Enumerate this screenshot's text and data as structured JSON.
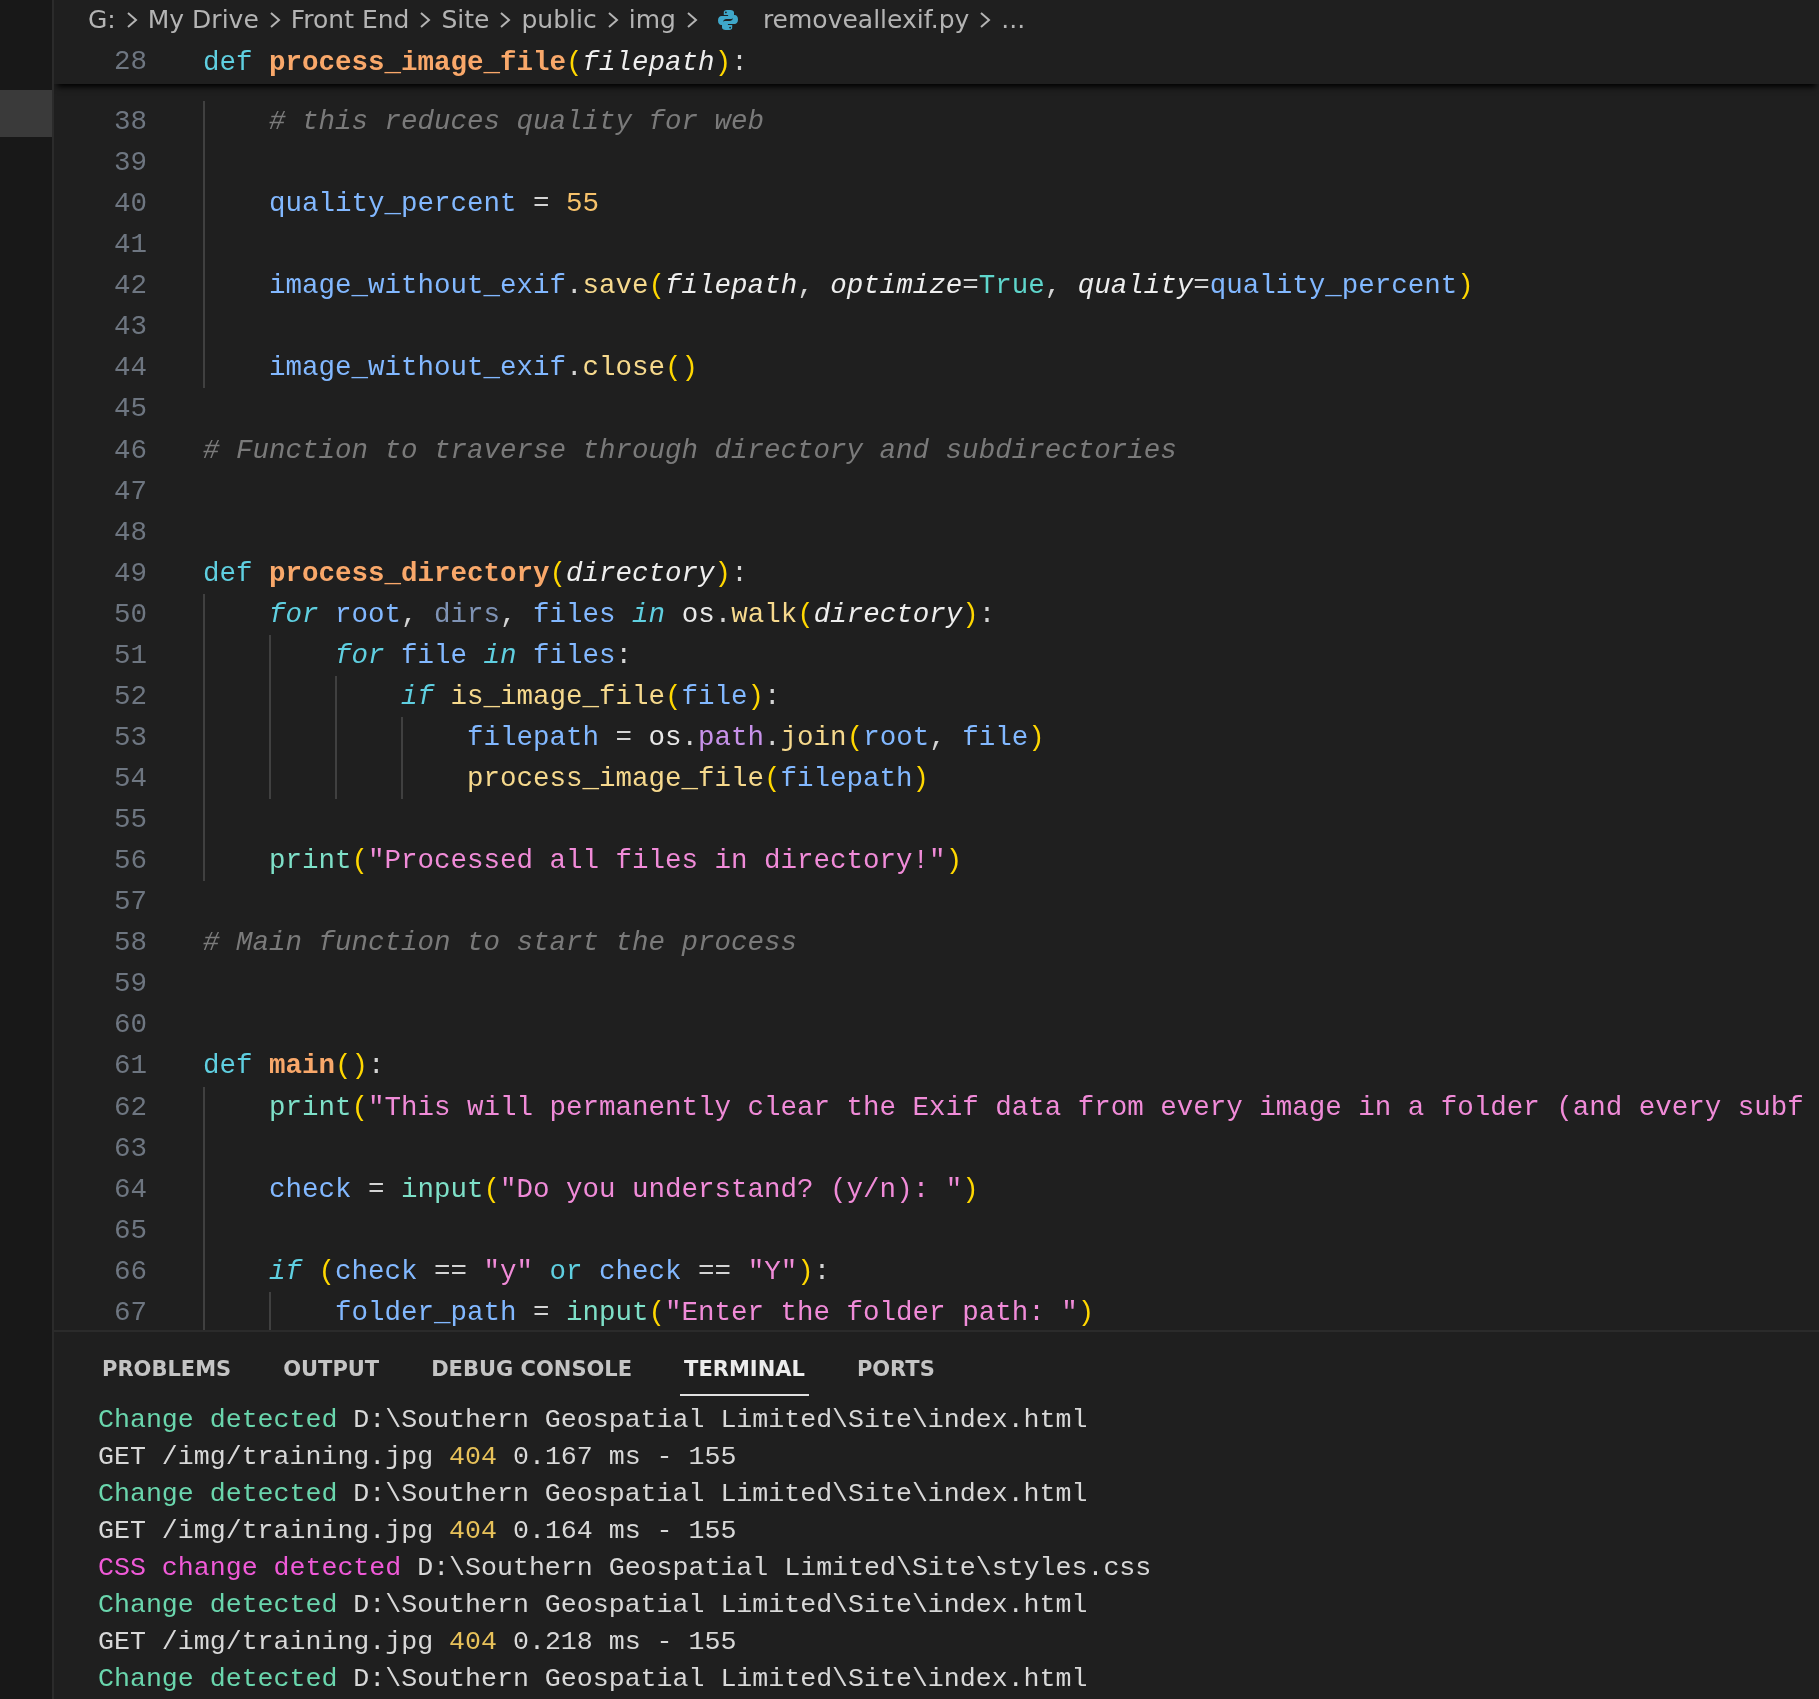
{
  "breadcrumb": {
    "items": [
      {
        "label": "G:"
      },
      {
        "label": "My Drive"
      },
      {
        "label": "Front End"
      },
      {
        "label": "Site"
      },
      {
        "label": "public"
      },
      {
        "label": "img"
      },
      {
        "label": "removeallexif.py",
        "kind": "file"
      },
      {
        "label": "..."
      }
    ]
  },
  "editor": {
    "sticky_line": {
      "number": "28",
      "tokens": [
        {
          "text": "def ",
          "kind": "kw"
        },
        {
          "text": "process_image_file",
          "kind": "fn"
        },
        {
          "text": "(",
          "kind": "paren"
        },
        {
          "text": "filepath",
          "kind": "param"
        },
        {
          "text": ")",
          "kind": "paren"
        },
        {
          "text": ":",
          "kind": "op"
        }
      ]
    },
    "lines": [
      {
        "number": "38",
        "tokens": [
          {
            "text": "    # this reduces quality for web",
            "kind": "comment"
          }
        ]
      },
      {
        "number": "39"
      },
      {
        "number": "40",
        "tokens": [
          {
            "text": "    quality_percent",
            "kind": "var"
          },
          {
            "text": " = ",
            "kind": "op"
          },
          {
            "text": "55",
            "kind": "num"
          }
        ]
      },
      {
        "number": "41"
      },
      {
        "number": "42",
        "tokens": [
          {
            "text": "    image_without_exif",
            "kind": "var"
          },
          {
            "text": ".",
            "kind": "op"
          },
          {
            "text": "save",
            "kind": "method"
          },
          {
            "text": "(",
            "kind": "paren"
          },
          {
            "text": "filepath",
            "kind": "param"
          },
          {
            "text": ", ",
            "kind": "op"
          },
          {
            "text": "optimize",
            "kind": "param"
          },
          {
            "text": "=",
            "kind": "op"
          },
          {
            "text": "True",
            "kind": "const"
          },
          {
            "text": ", ",
            "kind": "op"
          },
          {
            "text": "quality",
            "kind": "param"
          },
          {
            "text": "=",
            "kind": "op"
          },
          {
            "text": "quality_percent",
            "kind": "var"
          },
          {
            "text": ")",
            "kind": "paren"
          }
        ]
      },
      {
        "number": "43"
      },
      {
        "number": "44",
        "tokens": [
          {
            "text": "    image_without_exif",
            "kind": "var"
          },
          {
            "text": ".",
            "kind": "op"
          },
          {
            "text": "close",
            "kind": "method"
          },
          {
            "text": "()",
            "kind": "paren"
          }
        ]
      },
      {
        "number": "45"
      },
      {
        "number": "46",
        "tokens": [
          {
            "text": "# Function to traverse through directory and subdirectories",
            "kind": "comment"
          }
        ]
      },
      {
        "number": "47"
      },
      {
        "number": "48"
      },
      {
        "number": "49",
        "tokens": [
          {
            "text": "def ",
            "kind": "kw"
          },
          {
            "text": "process_directory",
            "kind": "fn"
          },
          {
            "text": "(",
            "kind": "paren"
          },
          {
            "text": "directory",
            "kind": "param"
          },
          {
            "text": ")",
            "kind": "paren"
          },
          {
            "text": ":",
            "kind": "op"
          }
        ]
      },
      {
        "number": "50",
        "tokens": [
          {
            "text": "    for ",
            "kind": "ctrl"
          },
          {
            "text": "root",
            "kind": "var"
          },
          {
            "text": ", ",
            "kind": "op"
          },
          {
            "text": "dirs",
            "kind": "unused"
          },
          {
            "text": ", ",
            "kind": "op"
          },
          {
            "text": "files ",
            "kind": "var"
          },
          {
            "text": "in ",
            "kind": "ctrl"
          },
          {
            "text": "os",
            "kind": "module"
          },
          {
            "text": ".",
            "kind": "op"
          },
          {
            "text": "walk",
            "kind": "method"
          },
          {
            "text": "(",
            "kind": "paren"
          },
          {
            "text": "directory",
            "kind": "param"
          },
          {
            "text": ")",
            "kind": "paren"
          },
          {
            "text": ":",
            "kind": "op"
          }
        ]
      },
      {
        "number": "51",
        "tokens": [
          {
            "text": "        for ",
            "kind": "ctrl"
          },
          {
            "text": "file ",
            "kind": "var"
          },
          {
            "text": "in ",
            "kind": "ctrl"
          },
          {
            "text": "files",
            "kind": "var"
          },
          {
            "text": ":",
            "kind": "op"
          }
        ]
      },
      {
        "number": "52",
        "tokens": [
          {
            "text": "            if ",
            "kind": "ctrl"
          },
          {
            "text": "is_image_file",
            "kind": "method"
          },
          {
            "text": "(",
            "kind": "paren"
          },
          {
            "text": "file",
            "kind": "var"
          },
          {
            "text": ")",
            "kind": "paren"
          },
          {
            "text": ":",
            "kind": "op"
          }
        ]
      },
      {
        "number": "53",
        "tokens": [
          {
            "text": "                filepath",
            "kind": "var"
          },
          {
            "text": " = ",
            "kind": "op"
          },
          {
            "text": "os",
            "kind": "module"
          },
          {
            "text": ".",
            "kind": "op"
          },
          {
            "text": "path",
            "kind": "prop"
          },
          {
            "text": ".",
            "kind": "op"
          },
          {
            "text": "join",
            "kind": "method"
          },
          {
            "text": "(",
            "kind": "paren"
          },
          {
            "text": "root",
            "kind": "var"
          },
          {
            "text": ", ",
            "kind": "op"
          },
          {
            "text": "file",
            "kind": "var"
          },
          {
            "text": ")",
            "kind": "paren"
          }
        ]
      },
      {
        "number": "54",
        "tokens": [
          {
            "text": "                process_image_file",
            "kind": "method"
          },
          {
            "text": "(",
            "kind": "paren"
          },
          {
            "text": "filepath",
            "kind": "var"
          },
          {
            "text": ")",
            "kind": "paren"
          }
        ]
      },
      {
        "number": "55"
      },
      {
        "number": "56",
        "tokens": [
          {
            "text": "    print",
            "kind": "builtin"
          },
          {
            "text": "(",
            "kind": "paren"
          },
          {
            "text": "\"Processed all files in directory!\"",
            "kind": "str"
          },
          {
            "text": ")",
            "kind": "paren"
          }
        ]
      },
      {
        "number": "57"
      },
      {
        "number": "58",
        "tokens": [
          {
            "text": "# Main function to start the process",
            "kind": "comment"
          }
        ]
      },
      {
        "number": "59"
      },
      {
        "number": "60"
      },
      {
        "number": "61",
        "tokens": [
          {
            "text": "def ",
            "kind": "kw"
          },
          {
            "text": "main",
            "kind": "fn"
          },
          {
            "text": "()",
            "kind": "paren"
          },
          {
            "text": ":",
            "kind": "op"
          }
        ]
      },
      {
        "number": "62",
        "tokens": [
          {
            "text": "    print",
            "kind": "builtin"
          },
          {
            "text": "(",
            "kind": "paren"
          },
          {
            "text": "\"This will permanently clear the Exif data from every image in a folder (and every subf",
            "kind": "str"
          }
        ]
      },
      {
        "number": "63"
      },
      {
        "number": "64",
        "tokens": [
          {
            "text": "    check",
            "kind": "var"
          },
          {
            "text": " = ",
            "kind": "op"
          },
          {
            "text": "input",
            "kind": "builtin"
          },
          {
            "text": "(",
            "kind": "paren"
          },
          {
            "text": "\"Do you understand? (y/n): \"",
            "kind": "str"
          },
          {
            "text": ")",
            "kind": "paren"
          }
        ]
      },
      {
        "number": "65"
      },
      {
        "number": "66",
        "tokens": [
          {
            "text": "    if ",
            "kind": "ctrl"
          },
          {
            "text": "(",
            "kind": "paren"
          },
          {
            "text": "check",
            "kind": "var"
          },
          {
            "text": " == ",
            "kind": "op"
          },
          {
            "text": "\"y\" ",
            "kind": "str"
          },
          {
            "text": "or ",
            "kind": "kw"
          },
          {
            "text": "check",
            "kind": "var"
          },
          {
            "text": " == ",
            "kind": "op"
          },
          {
            "text": "\"Y\"",
            "kind": "str"
          },
          {
            "text": ")",
            "kind": "paren"
          },
          {
            "text": ":",
            "kind": "op"
          }
        ]
      },
      {
        "number": "67",
        "tokens": [
          {
            "text": "        folder_path",
            "kind": "var"
          },
          {
            "text": " = ",
            "kind": "op"
          },
          {
            "text": "input",
            "kind": "builtin"
          },
          {
            "text": "(",
            "kind": "paren"
          },
          {
            "text": "\"Enter the folder path: \"",
            "kind": "str"
          },
          {
            "text": ")",
            "kind": "paren"
          }
        ]
      }
    ]
  },
  "panel": {
    "tabs": [
      {
        "label": "PROBLEMS",
        "selected": false
      },
      {
        "label": "OUTPUT",
        "selected": false
      },
      {
        "label": "DEBUG CONSOLE",
        "selected": false
      },
      {
        "label": "TERMINAL",
        "selected": true
      },
      {
        "label": "PORTS",
        "selected": false
      }
    ],
    "terminal": {
      "lines": [
        {
          "segments": [
            {
              "text": "Change detected",
              "kind": "change"
            },
            {
              "text": " D:\\Southern Geospatial Limited\\Site\\index.html",
              "kind": "plain"
            }
          ]
        },
        {
          "segments": [
            {
              "text": "GET /img/training.jpg ",
              "kind": "plain"
            },
            {
              "text": "404",
              "kind": "status"
            },
            {
              "text": " 0.167 ms - 155",
              "kind": "plain"
            }
          ]
        },
        {
          "segments": [
            {
              "text": "Change detected",
              "kind": "change"
            },
            {
              "text": " D:\\Southern Geospatial Limited\\Site\\index.html",
              "kind": "plain"
            }
          ]
        },
        {
          "segments": [
            {
              "text": "GET /img/training.jpg ",
              "kind": "plain"
            },
            {
              "text": "404",
              "kind": "status"
            },
            {
              "text": " 0.164 ms - 155",
              "kind": "plain"
            }
          ]
        },
        {
          "segments": [
            {
              "text": "CSS change detected",
              "kind": "css_change"
            },
            {
              "text": " D:\\Southern Geospatial Limited\\Site\\styles.css",
              "kind": "plain"
            }
          ]
        },
        {
          "segments": [
            {
              "text": "Change detected",
              "kind": "change"
            },
            {
              "text": " D:\\Southern Geospatial Limited\\Site\\index.html",
              "kind": "plain"
            }
          ]
        },
        {
          "segments": [
            {
              "text": "GET /img/training.jpg ",
              "kind": "plain"
            },
            {
              "text": "404",
              "kind": "status"
            },
            {
              "text": " 0.218 ms - 155",
              "kind": "plain"
            }
          ]
        },
        {
          "segments": [
            {
              "text": "Change detected",
              "kind": "change"
            },
            {
              "text": " D:\\Southern Geospatial Limited\\Site\\index.html",
              "kind": "plain"
            }
          ]
        }
      ]
    }
  }
}
